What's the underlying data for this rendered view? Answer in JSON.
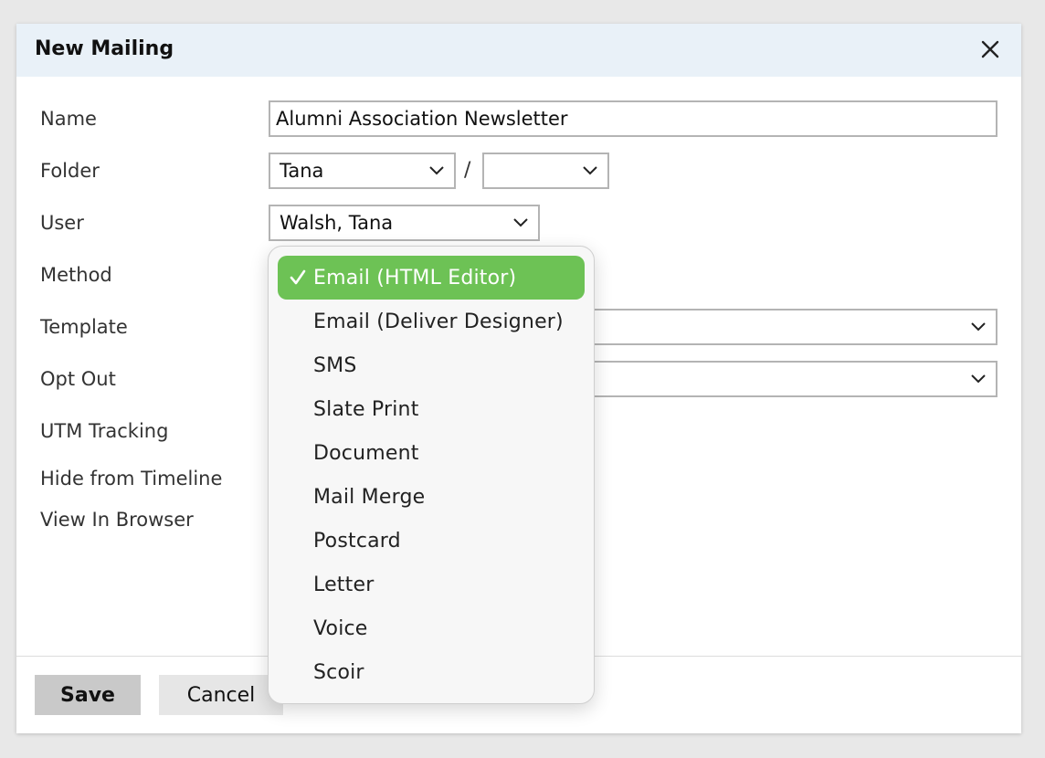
{
  "dialog": {
    "title": "New Mailing",
    "close_icon": "close-icon"
  },
  "form": {
    "name": {
      "label": "Name",
      "value": "Alumni Association Newsletter"
    },
    "folder": {
      "label": "Folder",
      "value": "Tana",
      "subfolder_value": "",
      "separator": "/"
    },
    "user": {
      "label": "User",
      "value": "Walsh, Tana"
    },
    "method": {
      "label": "Method"
    },
    "template": {
      "label": "Template"
    },
    "opt_out": {
      "label": "Opt Out"
    },
    "utm_tracking": {
      "label": "UTM Tracking"
    },
    "hide_from_timeline": {
      "label": "Hide from Timeline"
    },
    "view_in_browser": {
      "label": "View In Browser"
    }
  },
  "method_dropdown": {
    "selected_index": 0,
    "selected_color": "#6dc255",
    "options": [
      "Email (HTML Editor)",
      "Email (Deliver Designer)",
      "SMS",
      "Slate Print",
      "Document",
      "Mail Merge",
      "Postcard",
      "Letter",
      "Voice",
      "Scoir"
    ]
  },
  "footer": {
    "save_label": "Save",
    "cancel_label": "Cancel"
  }
}
